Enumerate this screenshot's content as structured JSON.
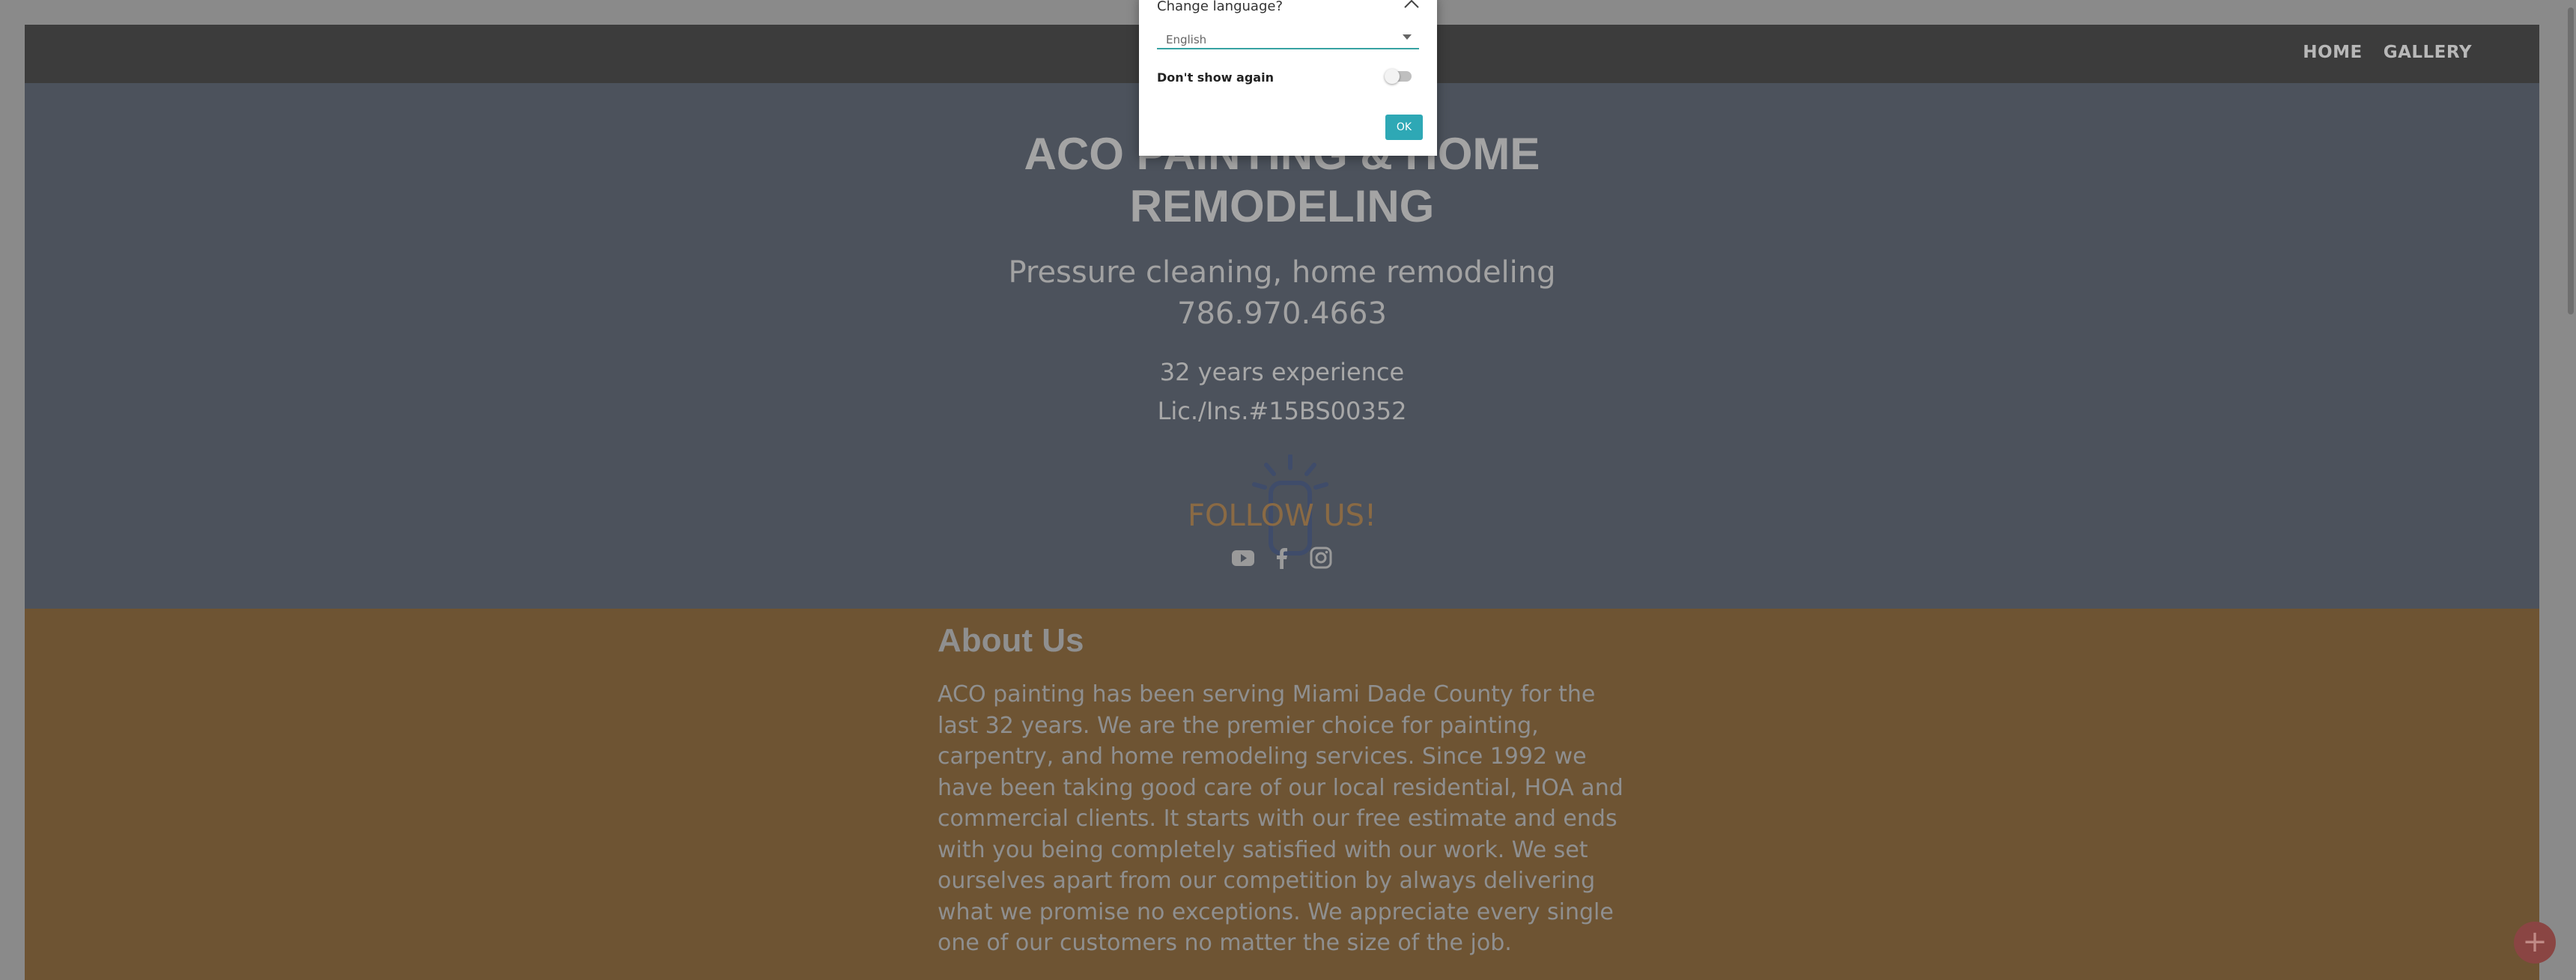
{
  "nav": {
    "items": [
      {
        "label": "HOME"
      },
      {
        "label": "GALLERY"
      }
    ]
  },
  "hero": {
    "title_line1": "ACO PAINTING & HOME",
    "title_line2": "REMODELING",
    "subtitle_line1": "Pressure cleaning, home remodeling",
    "phone": "786.970.4663",
    "experience": "32 years experience",
    "license": "Lic./Ins.#15BS00352",
    "follow_label": "FOLLOW US!",
    "socials": [
      {
        "icon": "youtube-icon"
      },
      {
        "icon": "facebook-icon"
      },
      {
        "icon": "instagram-icon"
      }
    ]
  },
  "about": {
    "title": "About Us",
    "body": "ACO painting has been serving Miami Dade County for the last 32 years. We are the premier choice for painting, carpentry, and home remodeling services. Since 1992 we have been taking good care of our local residential, HOA and commercial clients. It starts with our free estimate and ends with you being completely satisfied with our work. We set ourselves apart from our competition by always delivering what we promise no exceptions. We appreciate every single one of our customers no matter the size of the job."
  },
  "fab": {
    "label": "+"
  },
  "modal": {
    "title": "Change language?",
    "selected_language": "English",
    "dont_show_label": "Don't show again",
    "dont_show_checked": false,
    "ok_label": "OK"
  },
  "colors": {
    "accent": "#2ea8b5",
    "hero_bg": "#4c525c",
    "about_bg": "#6e5433",
    "follow": "#8a6a44"
  }
}
